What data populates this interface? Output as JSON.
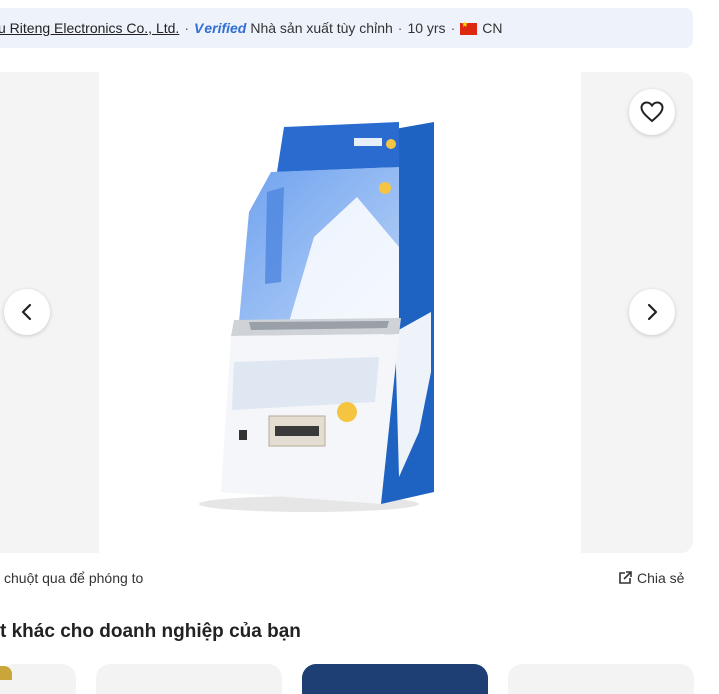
{
  "supplier": {
    "name": "u Riteng Electronics Co., Ltd.",
    "separator": "·",
    "verified_label": "erified",
    "verified_mark": "V",
    "type": "Nhà sản xuất tùy chỉnh",
    "years": "10 yrs",
    "country": "CN"
  },
  "gallery": {
    "icons": {
      "favorite": "heart-icon",
      "prev": "chevron-left-icon",
      "next": "chevron-right-icon"
    }
  },
  "hint": "chuột qua để phóng to",
  "share_label": "Chia sẻ",
  "section_title": "t khác cho doanh nghiệp của bạn",
  "colors": {
    "accent": "#2f6fd6",
    "machine_blue": "#1f63c2",
    "bar_bg": "#eef2fb"
  }
}
